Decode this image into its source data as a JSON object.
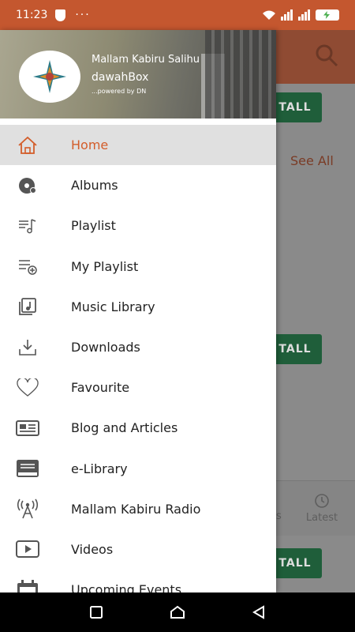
{
  "status_bar": {
    "time": "11:23",
    "dots": "···"
  },
  "background": {
    "install_label": "TALL",
    "see_all": "See All",
    "tab_partial": "s",
    "tab_latest": "Latest"
  },
  "drawer": {
    "header": {
      "name": "Mallam Kabiru Salihu",
      "app": "dawahBox",
      "powered": "...powered by DN"
    },
    "items": [
      {
        "label": "Home",
        "icon": "home-icon",
        "active": true
      },
      {
        "label": "Albums",
        "icon": "album-disc-icon"
      },
      {
        "label": "Playlist",
        "icon": "playlist-icon"
      },
      {
        "label": "My Playlist",
        "icon": "playlist-add-icon"
      },
      {
        "label": "Music Library",
        "icon": "music-library-icon"
      },
      {
        "label": "Downloads",
        "icon": "download-icon"
      },
      {
        "label": "Favourite",
        "icon": "heart-icon"
      },
      {
        "label": "Blog and Articles",
        "icon": "newspaper-icon"
      },
      {
        "label": "e-Library",
        "icon": "book-icon"
      },
      {
        "label": "Mallam Kabiru Radio",
        "icon": "radio-tower-icon"
      },
      {
        "label": "Videos",
        "icon": "video-icon"
      },
      {
        "label": "Upcoming Events",
        "icon": "calendar-icon"
      }
    ]
  },
  "colors": {
    "accent": "#d35d2a",
    "status_bar": "#c4572f",
    "install_button": "#1f5e3a"
  }
}
